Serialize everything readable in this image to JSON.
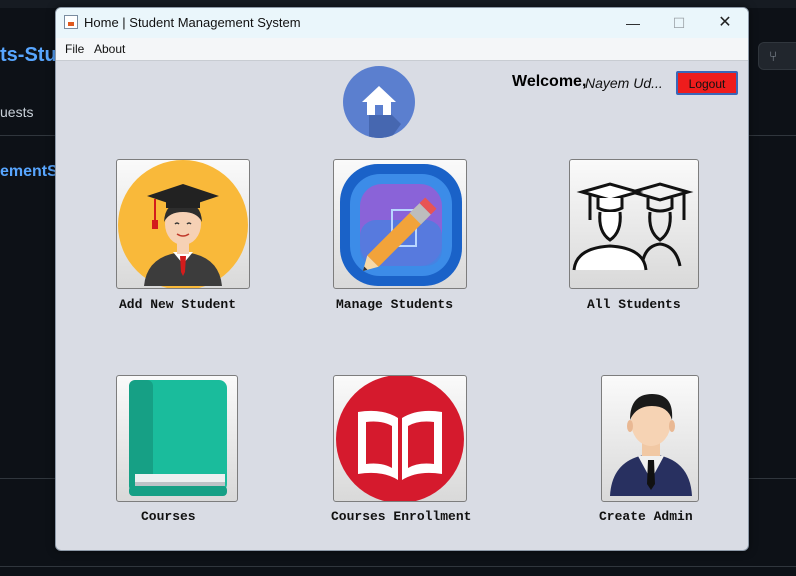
{
  "background": {
    "repo_title": "ts-Stuc",
    "tab_text": "uests",
    "repo_link": "ementSy"
  },
  "window": {
    "title": "Home | Student Management System",
    "controls": {
      "minimize": "—",
      "maximize": "☐",
      "close": "✕"
    }
  },
  "menu": {
    "items": [
      "File",
      "About"
    ]
  },
  "header": {
    "welcome_label": "Welcome,",
    "user_name": "Nayem Ud...",
    "logout_label": "Logout"
  },
  "tiles": [
    {
      "label": "Add New Student",
      "icon": "graduate-student-icon"
    },
    {
      "label": "Manage Students",
      "icon": "pencil-edit-icon"
    },
    {
      "label": "All Students",
      "icon": "students-group-icon"
    },
    {
      "label": "Courses",
      "icon": "book-icon"
    },
    {
      "label": "Courses Enrollment",
      "icon": "open-book-icon"
    },
    {
      "label": "Create Admin",
      "icon": "admin-user-icon"
    }
  ],
  "colors": {
    "window_bg": "#d9dce4",
    "logout_bg": "#ee1c1c",
    "home_icon_bg": "#5b7fcf",
    "graduate_bg": "#f9b93a",
    "book_bg": "#1abc9c",
    "enrollment_bg": "#d51a2d"
  }
}
